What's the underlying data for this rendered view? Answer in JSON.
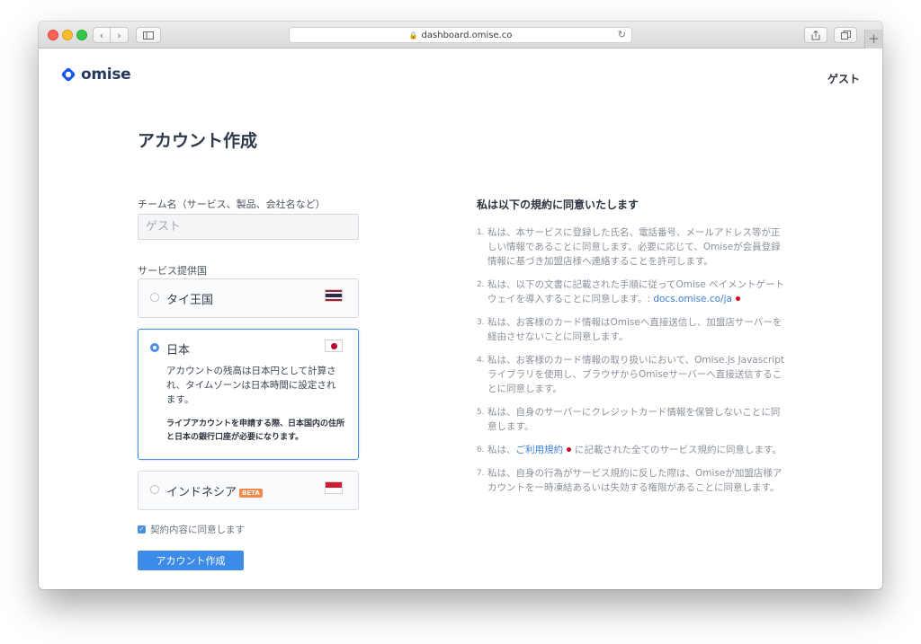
{
  "browser": {
    "url": "dashboard.omise.co",
    "colors": {
      "close": "#fc5f57",
      "minimize": "#fdbc2e",
      "zoom": "#33c748"
    }
  },
  "header": {
    "logo_text": "omise",
    "logo_color": "#253b5d",
    "guest_label": "ゲスト"
  },
  "form": {
    "title": "アカウント作成",
    "team_label": "チーム名（サービス、製品、会社名など）",
    "team_placeholder": "ゲスト",
    "country_label": "サービス提供国",
    "countries": [
      {
        "name": "タイ王国",
        "flag": "thailand-flag",
        "selected": false
      },
      {
        "name": "日本",
        "flag": "japan-flag",
        "selected": true,
        "description": "アカウントの残高は日本円として計算され、タイムゾーンは日本時間に設定されます。",
        "note": "ライブアカウントを申請する際、日本国内の住所と日本の銀行口座が必要になります。"
      },
      {
        "name": "インドネシア",
        "flag": "indonesia-flag",
        "selected": false,
        "badge": "BETA"
      }
    ],
    "agree_label": "契約内容に同意します",
    "agree_checked": true,
    "submit_label": "アカウント作成",
    "accent_color": "#3d8be8"
  },
  "terms": {
    "title": "私は以下の規約に同意いたします",
    "items": [
      {
        "num": "1.",
        "text": "私は、本サービスに登録した氏名、電話番号、メールアドレス等が正しい情報であることに同意します。必要に応じて、Omiseが会員登録情報に基づき加盟店様へ連絡することを許可します。"
      },
      {
        "num": "2.",
        "pre": "私は、以下の文書に記載された手順に従ってOmise ペイメントゲートウェイを導入することに同意します。: ",
        "link": "docs.omise.co/ja"
      },
      {
        "num": "3.",
        "text": "私は、お客様のカード情報はOmiseへ直接送信し、加盟店サーバーを経由させないことに同意します。"
      },
      {
        "num": "4.",
        "text": "私は、お客様のカード情報の取り扱いにおいて、Omise.js Javascriptライブラリを使用し、ブラウザからOmiseサーバーへ直接送信することに同意します。"
      },
      {
        "num": "5.",
        "text": "私は、自身のサーバーにクレジットカード情報を保管しないことに同意します。"
      },
      {
        "num": "6.",
        "pre": "私は、",
        "link": "ご利用規約",
        "post": "に記載された全てのサービス規約に同意します。"
      },
      {
        "num": "7.",
        "text": "私は、自身の行為がサービス規約に反した際は、Omiseが加盟店様アカウントを一時凍結あるいは失効する権限があることに同意します。"
      }
    ]
  }
}
